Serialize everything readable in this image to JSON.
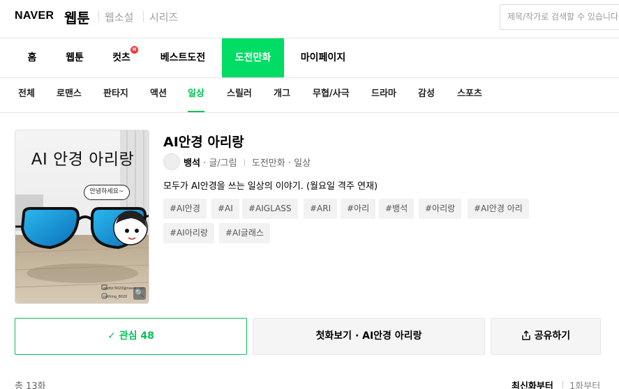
{
  "header": {
    "logo": "NAVER",
    "brand": "웹툰",
    "links": [
      "웹소설",
      "시리즈"
    ],
    "search_placeholder": "제목/작가로 검색할 수 있습니다."
  },
  "main_tabs": [
    {
      "label": "홈"
    },
    {
      "label": "웹툰"
    },
    {
      "label": "컷츠",
      "badge": "N"
    },
    {
      "label": "베스트도전"
    },
    {
      "label": "도전만화",
      "active": true
    },
    {
      "label": "마이페이지"
    }
  ],
  "genre_tabs": [
    {
      "label": "전체"
    },
    {
      "label": "로맨스"
    },
    {
      "label": "판타지"
    },
    {
      "label": "액션"
    },
    {
      "label": "일상",
      "active": true
    },
    {
      "label": "스릴러"
    },
    {
      "label": "개그"
    },
    {
      "label": "무협/사극"
    },
    {
      "label": "드라마"
    },
    {
      "label": "감성"
    },
    {
      "label": "스포츠"
    }
  ],
  "cover": {
    "title_text": "AI 안경 아리랑",
    "bubble_text": "안녕하세요~",
    "contact_1": "godtjr.5020@naver.com",
    "contact_2": "nothing_8020"
  },
  "comic": {
    "title": "AI안경 아리랑",
    "author": "뱅석",
    "author_role": "· 글/그림",
    "category": "도전만화 · 일상",
    "description": "모두가 AI안경을 쓰는 일상의 이야기. (월요일 격주 연재)",
    "tags": [
      "#AI안경",
      "#AI",
      "#AIGLASS",
      "#ARI",
      "#아리",
      "#뱅석",
      "#아리랑",
      "#AI안경 아리",
      "#AI아리랑",
      "#AI글래스"
    ]
  },
  "actions": {
    "favorite_label": "관심 48",
    "first_episode_label": "첫화보기 · AI안경 아리랑",
    "share_label": "공유하기"
  },
  "episodes": {
    "total": "총 13화",
    "sort_latest": "최신화부터",
    "sort_first": "1화부터"
  },
  "colors": {
    "accent": "#00dc64",
    "accent_text": "#00c356",
    "badge": "#ff3333"
  }
}
